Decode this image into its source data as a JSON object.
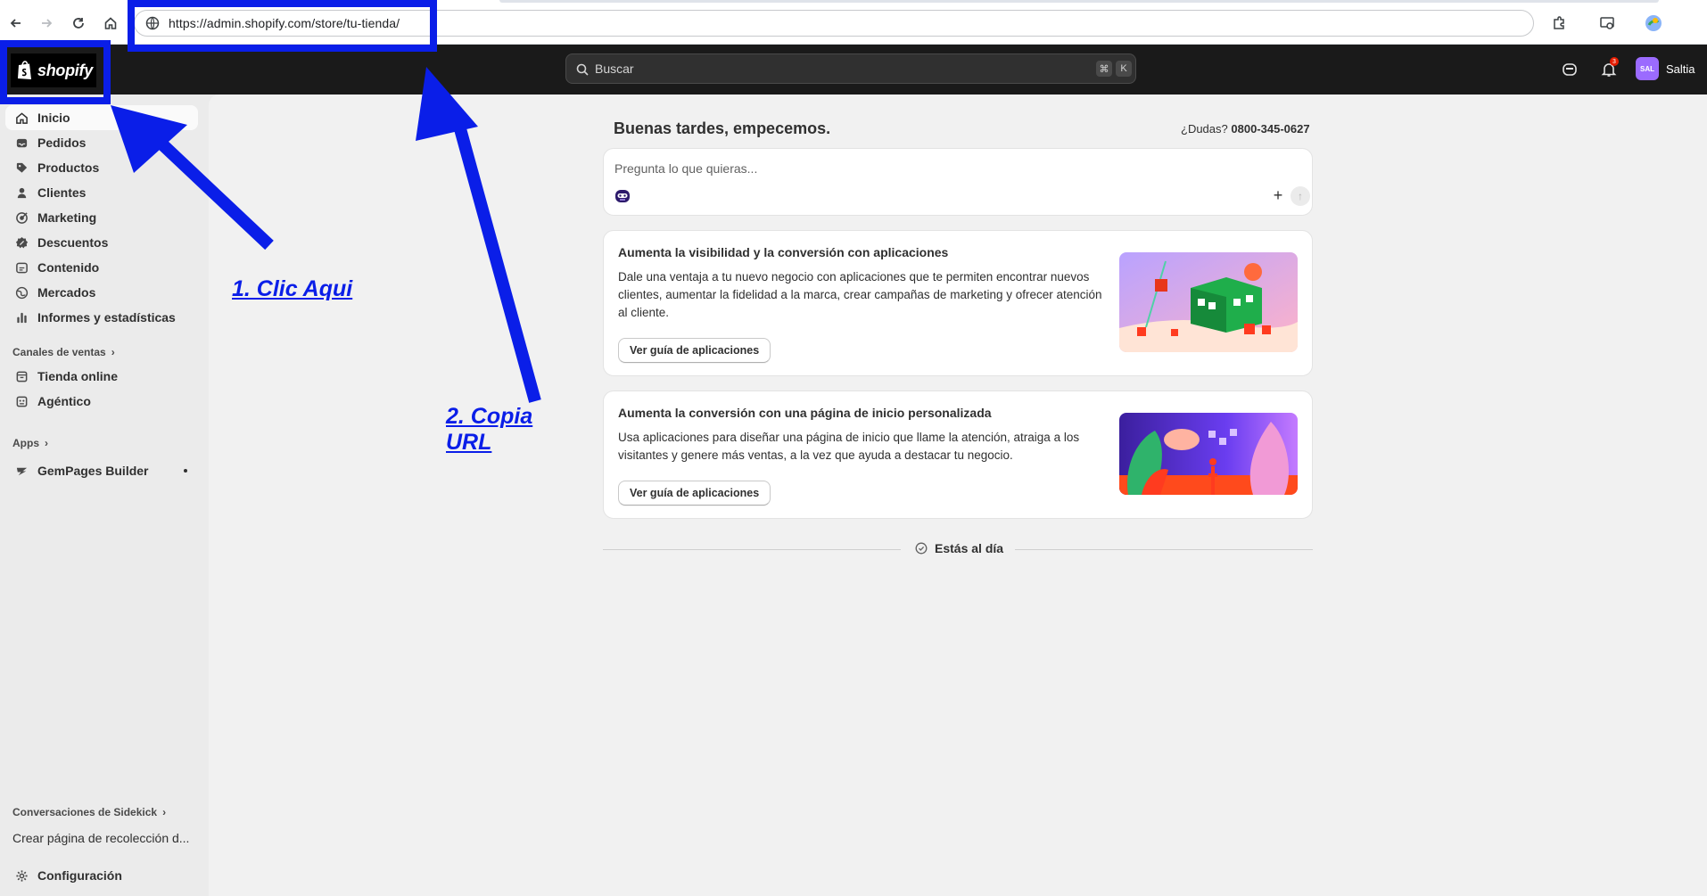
{
  "browser": {
    "url": "https://admin.shopify.com/store/tu-tienda/"
  },
  "topbar": {
    "logo_text": "shopify",
    "search_placeholder": "Buscar",
    "shortcut_cmd": "⌘",
    "shortcut_key": "K",
    "notification_count": "3",
    "avatar_initials": "SAL",
    "user_name": "Saltia"
  },
  "sidebar": {
    "items": [
      {
        "label": "Inicio",
        "icon": "home-icon"
      },
      {
        "label": "Pedidos",
        "icon": "inbox-icon"
      },
      {
        "label": "Productos",
        "icon": "tag-icon"
      },
      {
        "label": "Clientes",
        "icon": "person-icon"
      },
      {
        "label": "Marketing",
        "icon": "target-icon"
      },
      {
        "label": "Descuentos",
        "icon": "discount-icon"
      },
      {
        "label": "Contenido",
        "icon": "content-icon"
      },
      {
        "label": "Mercados",
        "icon": "globe-icon"
      },
      {
        "label": "Informes y estadísticas",
        "icon": "bar-chart-icon"
      }
    ],
    "sales_channels_label": "Canales de ventas",
    "sales_channels": [
      {
        "label": "Tienda online",
        "icon": "store-icon"
      },
      {
        "label": "Agéntico",
        "icon": "agentic-icon"
      }
    ],
    "apps_label": "Apps",
    "apps": [
      {
        "label": "GemPages Builder",
        "icon": "gempages-icon"
      }
    ],
    "sidekick_label": "Conversaciones de Sidekick",
    "sidekick_item": "Crear página de recolección d...",
    "settings_label": "Configuración"
  },
  "main": {
    "greeting": "Buenas tardes, empecemos.",
    "help_prefix": "¿Dudas?",
    "help_phone": "0800-345-0627",
    "ask_placeholder": "Pregunta lo que quieras...",
    "cards": [
      {
        "title": "Aumenta la visibilidad y la conversión con aplicaciones",
        "body": "Dale una ventaja a tu nuevo negocio con aplicaciones que te permiten encontrar nuevos clientes, aumentar la fidelidad a la marca, crear campañas de marketing y ofrecer atención al cliente.",
        "button": "Ver guía de aplicaciones"
      },
      {
        "title": "Aumenta la conversión con una página de inicio personalizada",
        "body": "Usa aplicaciones para diseñar una página de inicio que llame la atención, atraiga a los visitantes y genere más ventas, a la vez que ayuda a destacar tu negocio.",
        "button": "Ver guía de aplicaciones"
      }
    ],
    "up_to_date": "Estás al día"
  },
  "annotations": {
    "step1": "1. Clic Aqui",
    "step2_line1": "2. Copia",
    "step2_line2": "URL",
    "color": "#0a1ee8"
  }
}
